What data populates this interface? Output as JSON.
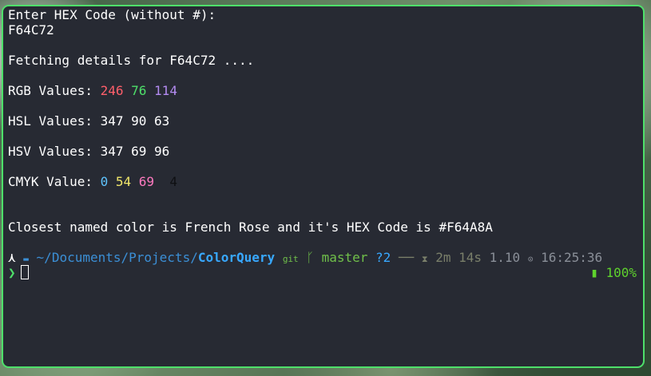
{
  "terminal": {
    "prompt_line": "Enter HEX Code (without #):",
    "input_value": "F64C72",
    "fetching": "Fetching details for F64C72 ....",
    "rgb": {
      "label": "RGB Values: ",
      "r": "246",
      "g": "76",
      "b": "114"
    },
    "hsl": {
      "label": "HSL Values: ",
      "value": "347 90 63"
    },
    "hsv": {
      "label": "HSV Values: ",
      "value": "347 69 96"
    },
    "cmyk": {
      "label": "CMYK Value: ",
      "c": "0",
      "m": "54",
      "y": "69",
      "k": "4"
    },
    "closest": "Closest named color is French Rose and it's HEX Code is #F64A8A"
  },
  "prompt": {
    "arch_icon": "arch-icon",
    "folder_icon": "folder-icon",
    "path_prefix": "~/Documents/Projects/",
    "path_current": "ColorQuery",
    "git_icon": "git",
    "branch_icon": "branch-icon",
    "branch": "master",
    "untracked": "?2",
    "separator": "──",
    "hourglass_icon": "hourglass-icon",
    "duration": "2m 14s",
    "load": "1.10",
    "clock_icon": "clock-icon",
    "time": "16:25:36",
    "caret": "❯",
    "battery_icon": "battery-icon",
    "battery": "100%"
  },
  "colors": {
    "border": "#4ee06a",
    "background": "#272a33",
    "red": "#ff5f6b",
    "green": "#4ee06a",
    "purple": "#b48cf2",
    "blue": "#5fc4ff",
    "yellow": "#f1e76a",
    "magenta": "#ff7ac0"
  }
}
